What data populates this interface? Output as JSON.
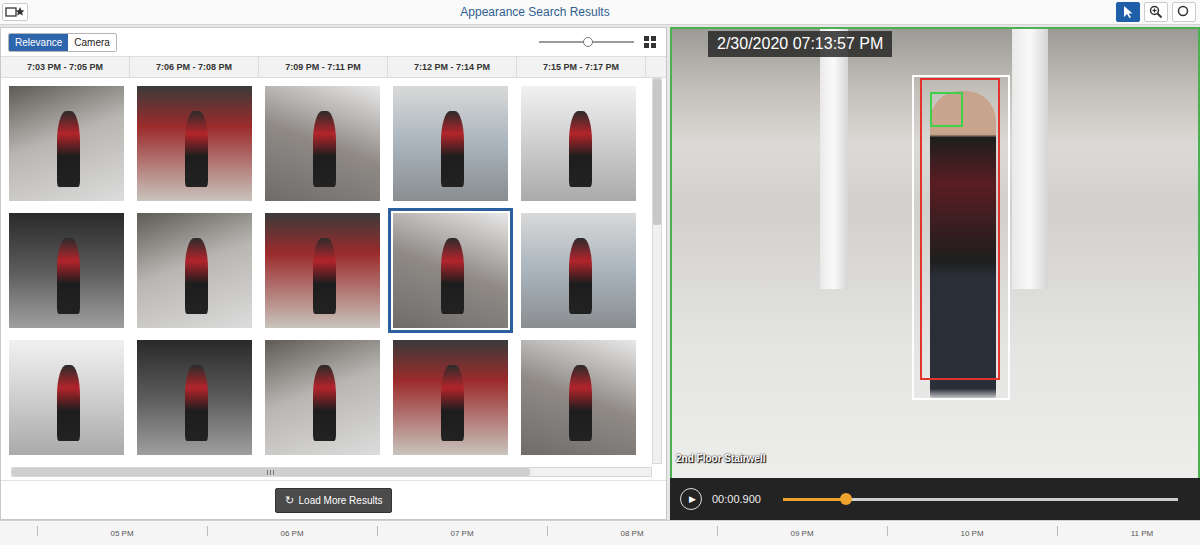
{
  "window": {
    "title": "Appearance Search Results"
  },
  "tools": [
    {
      "kind": "pointer",
      "selected": true
    },
    {
      "kind": "zoom",
      "selected": false
    },
    {
      "kind": "more",
      "selected": false
    }
  ],
  "sort_tabs": [
    {
      "label": "Relevance",
      "selected": true
    },
    {
      "label": "Camera",
      "selected": false
    }
  ],
  "size_slider": {
    "level": 0.52
  },
  "columns": [
    "7:03 PM - 7:05 PM",
    "7:06 PM - 7:08 PM",
    "7:09 PM - 7:11 PM",
    "7:12 PM - 7:14 PM",
    "7:15 PM - 7:17 PM"
  ],
  "thumbnails": [
    {
      "selected": false
    },
    {
      "selected": false
    },
    {
      "selected": false
    },
    {
      "selected": false
    },
    {
      "selected": false
    },
    {
      "selected": false
    },
    {
      "selected": false
    },
    {
      "selected": false
    },
    {
      "selected": true
    },
    {
      "selected": false
    },
    {
      "selected": false
    },
    {
      "selected": false
    },
    {
      "selected": false
    },
    {
      "selected": false
    },
    {
      "selected": false
    }
  ],
  "scrollbars": {
    "vertical_level": 0.38,
    "horizontal_level": 0.81
  },
  "load_more": {
    "icon": "↻",
    "label": "Load More Results"
  },
  "player": {
    "timestamp": "2/30/2020 07:13:57 PM",
    "camera": "2nd Floor Stairwell",
    "play_icon": "▶",
    "time": "00:00.900",
    "level": 0.16
  },
  "timeline": {
    "ticks": [
      "05 PM",
      "06 PM",
      "07 PM",
      "08 PM",
      "09 PM",
      "10 PM",
      "11 PM"
    ]
  }
}
